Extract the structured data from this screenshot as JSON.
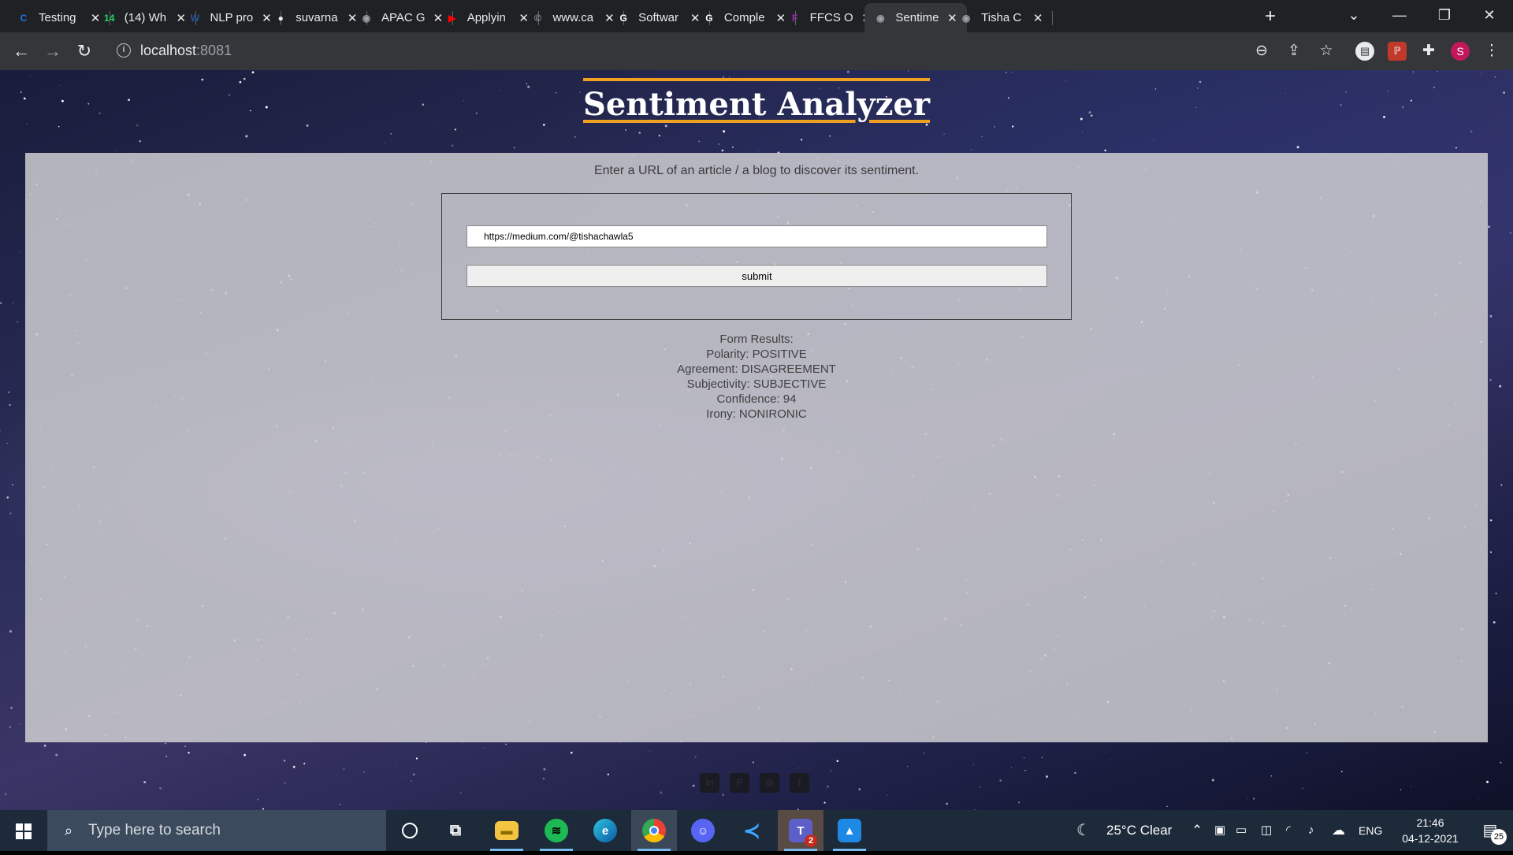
{
  "browser": {
    "tabs": [
      {
        "title": "Testing",
        "icon": "c-icon",
        "color": "#1a73e8",
        "glyph": "C"
      },
      {
        "title": "(14) Wh",
        "icon": "whatsapp-icon",
        "color": "#25d366",
        "glyph": "14"
      },
      {
        "title": "NLP pro",
        "icon": "word-icon",
        "color": "#2b579a",
        "glyph": "W"
      },
      {
        "title": "suvarna",
        "icon": "github-icon",
        "color": "#e8eaed",
        "glyph": "●"
      },
      {
        "title": "APAC G",
        "icon": "globe-icon",
        "color": "#9aa0a6",
        "glyph": "◉"
      },
      {
        "title": "Applyin",
        "icon": "youtube-icon",
        "color": "#ff0000",
        "glyph": "▶"
      },
      {
        "title": "www.ca",
        "icon": "c-circle-icon",
        "color": "#9aa0a6",
        "glyph": "©"
      },
      {
        "title": "Softwar",
        "icon": "google-icon",
        "color": "#ffffff",
        "glyph": "G"
      },
      {
        "title": "Comple",
        "icon": "google-icon",
        "color": "#ffffff",
        "glyph": "G"
      },
      {
        "title": "FFCS O",
        "icon": "ffcs-icon",
        "color": "#9c27b0",
        "glyph": "F"
      },
      {
        "title": "Sentime",
        "icon": "globe-icon",
        "color": "#9aa0a6",
        "glyph": "◉",
        "active": true
      },
      {
        "title": "Tisha C",
        "icon": "globe-icon",
        "color": "#9aa0a6",
        "glyph": "◉"
      }
    ],
    "url_host": "localhost",
    "url_port": ":8081",
    "profile_initial": "S"
  },
  "page": {
    "title": "Sentiment Analyzer",
    "intro": "Enter a URL of an article / a blog to discover its sentiment.",
    "url_input_value": "https://medium.com/@tishachawla5",
    "submit_label": "submit",
    "results": {
      "heading": "Form Results:",
      "polarity": "Polarity: POSITIVE",
      "agreement": "Agreement: DISAGREEMENT",
      "subjectivity": "Subjectivity: SUBJECTIVE",
      "confidence": "Confidence: 94",
      "irony": "Irony: NONIRONIC"
    },
    "social_icons": [
      "linkedin-icon",
      "pinterest-icon",
      "instagram-icon",
      "facebook-icon"
    ]
  },
  "taskbar": {
    "search_placeholder": "Type here to search",
    "weather": "25°C  Clear",
    "language": "ENG",
    "time": "21:46",
    "date": "04-12-2021",
    "notification_count": "25",
    "teams_badge": "2"
  }
}
